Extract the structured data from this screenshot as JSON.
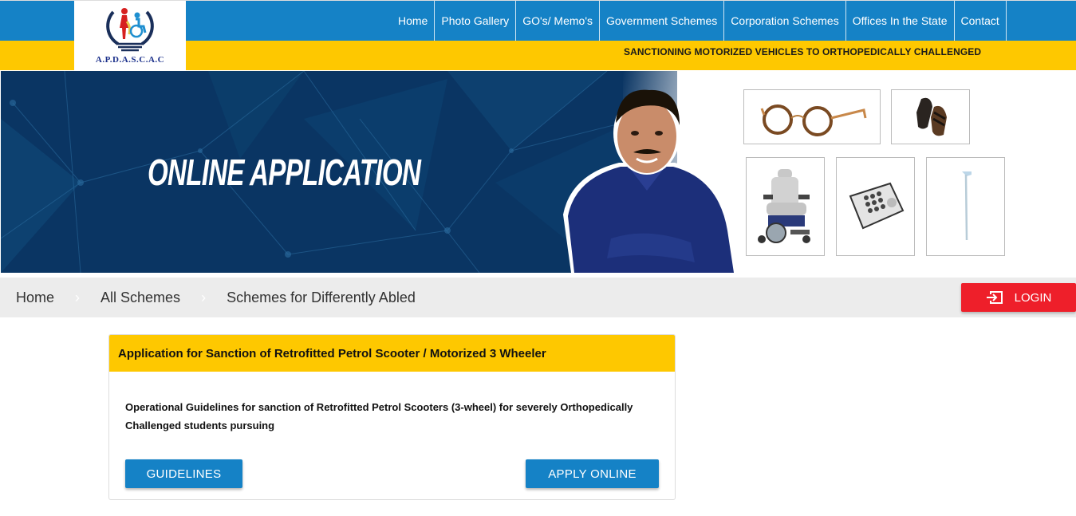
{
  "logo": {
    "text": "A.P.D.A.S.C.A.C",
    "icon": "apdascac-logo-icon"
  },
  "nav": {
    "items": [
      {
        "label": "Home"
      },
      {
        "label": "Photo Gallery"
      },
      {
        "label": "GO's/ Memo's"
      },
      {
        "label": "Government Schemes"
      },
      {
        "label": "Corporation Schemes"
      },
      {
        "label": "Offices In the State"
      },
      {
        "label": "Contact"
      }
    ]
  },
  "marquee": {
    "text": "SANCTIONING MOTORIZED VEHICLES TO ORTHOPEDICALLY CHALLENGED"
  },
  "banner": {
    "title": "ONLINE APPLICATION",
    "products": [
      "spectacles",
      "footwear",
      "motorized-wheelchair",
      "braille-audio-player",
      "walking-cane"
    ]
  },
  "breadcrumb": {
    "items": [
      {
        "label": "Home"
      },
      {
        "label": "All Schemes"
      },
      {
        "label": "Schemes for Differently Abled"
      }
    ],
    "separator": "›"
  },
  "login": {
    "label": "LOGIN",
    "icon": "login-icon"
  },
  "card": {
    "title": "Application for Sanction of Retrofitted Petrol Scooter / Motorized 3 Wheeler",
    "description": "Operational Guidelines for sanction of Retrofitted Petrol Scooters (3-wheel) for severely Orthopedically Challenged students pursuing",
    "guidelines_label": "GUIDELINES",
    "apply_label": "APPLY ONLINE"
  },
  "colors": {
    "nav_blue": "#1582c6",
    "accent_yellow": "#fec800",
    "login_red": "#ee1f2a",
    "banner_navy": "#0a3563"
  }
}
